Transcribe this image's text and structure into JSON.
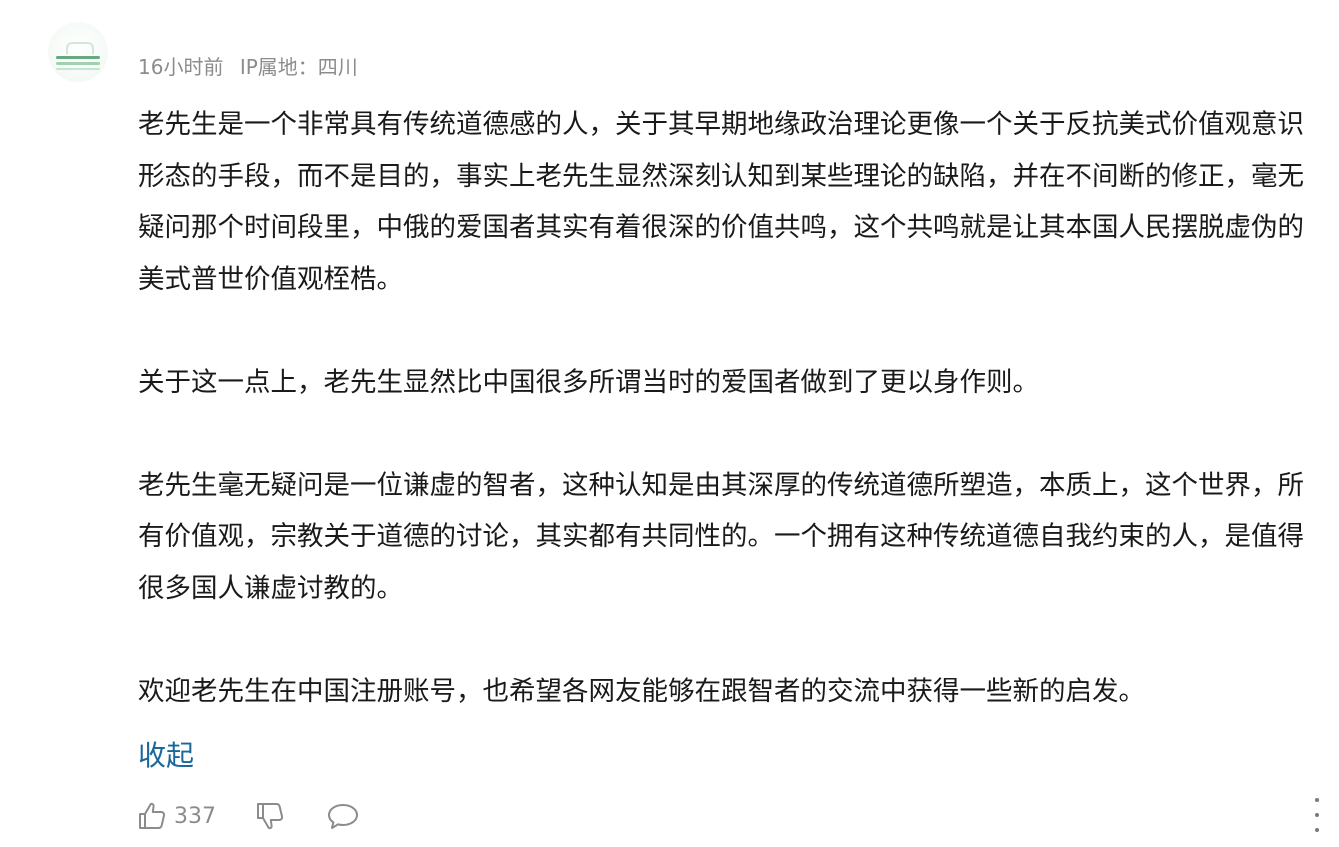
{
  "comment": {
    "time": "16小时前",
    "ip_location": "IP属地：四川",
    "paragraphs": [
      "老先生是一个非常具有传统道德感的人，关于其早期地缘政治理论更像一个关于反抗美式价值观意识形态的手段，而不是目的，事实上老先生显然深刻认知到某些理论的缺陷，并在不间断的修正，毫无疑问那个时间段里，中俄的爱国者其实有着很深的价值共鸣，这个共鸣就是让其本国人民摆脱虚伪的美式普世价值观桎梏。",
      "关于这一点上，老先生显然比中国很多所谓当时的爱国者做到了更以身作则。",
      "老先生毫无疑问是一位谦虚的智者，这种认知是由其深厚的传统道德所塑造，本质上，这个世界，所有价值观，宗教关于道德的讨论，其实都有共同性的。一个拥有这种传统道德自我约束的人，是值得很多国人谦虚讨教的。",
      "欢迎老先生在中国注册账号，也希望各网友能够在跟智者的交流中获得一些新的启发。"
    ],
    "collapse_label": "收起",
    "like_count": "337"
  },
  "icons": {
    "like": "thumbs-up-icon",
    "dislike": "thumbs-down-icon",
    "comment": "comment-bubble-icon",
    "more": "more-vertical-icon"
  },
  "colors": {
    "link": "#19679b",
    "meta": "#8c8c8c",
    "text": "#1a1a1a"
  }
}
